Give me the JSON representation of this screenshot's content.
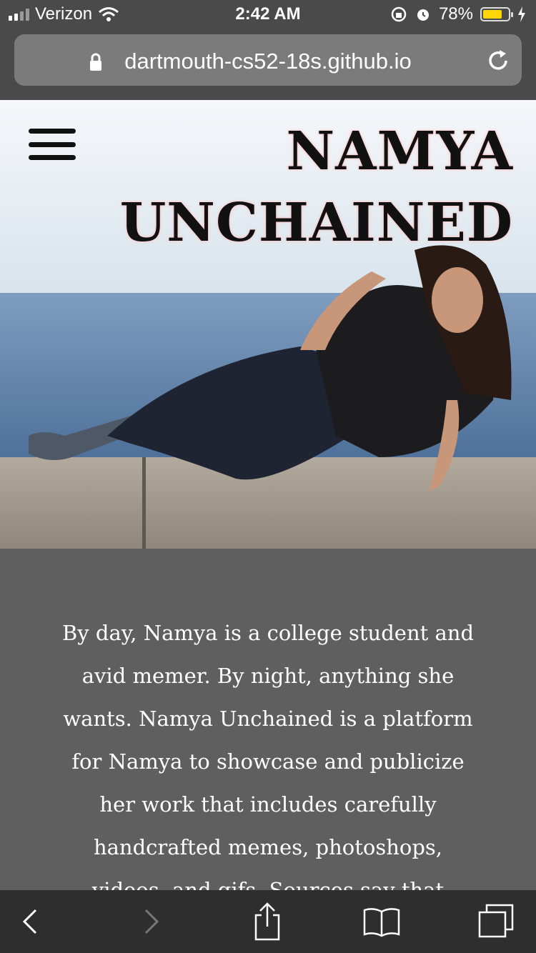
{
  "status": {
    "carrier": "Verizon",
    "time": "2:42 AM",
    "battery_percent": "78%",
    "battery_level": 0.78,
    "battery_color": "#ffd60a"
  },
  "browser": {
    "url": "dartmouth-cs52-18s.github.io",
    "icons": [
      "lock-icon",
      "reload-icon"
    ]
  },
  "hero": {
    "title_line1": "NAMYA",
    "title_line2": "UNCHAINED",
    "menu_icon": "hamburger-menu-icon"
  },
  "intro": {
    "text": "By day, Namya is a college student and avid memer. By night, anything she wants. Namya Unchained is a platform for Namya to showcase and publicize her work that includes carefully handcrafted memes, photoshops, videos, and gifs. Sources say that people"
  },
  "toolbar": {
    "items": [
      "back-icon",
      "forward-icon",
      "share-icon",
      "bookmarks-icon",
      "tabs-icon"
    ]
  }
}
